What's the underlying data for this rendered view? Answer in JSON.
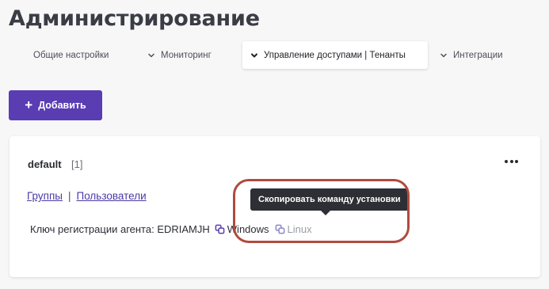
{
  "page": {
    "title": "Администрирование"
  },
  "tabs": [
    {
      "label": "Общие настройки",
      "has_chevron": false,
      "active": false
    },
    {
      "label": "Мониторинг",
      "has_chevron": true,
      "active": false
    },
    {
      "label": "Управление доступами | Тенанты",
      "has_chevron": true,
      "active": true
    },
    {
      "label": "Интеграции",
      "has_chevron": true,
      "active": false
    }
  ],
  "actions": {
    "add_label": "Добавить",
    "add_icon": "plus-icon"
  },
  "tenant": {
    "name": "default",
    "count": "[1]",
    "more_icon": "more-horizontal-icon",
    "links": {
      "groups": "Группы",
      "separator": "|",
      "users": "Пользователи"
    },
    "registration": {
      "label": "Ключ регистрации агента: EDRIAMJH",
      "windows_label": "Windows",
      "linux_label": "Linux",
      "copy_icon": "copy-icon"
    }
  },
  "tooltip": {
    "text": "Скопировать команду установки"
  },
  "colors": {
    "accent": "#5a3cb3",
    "link": "#4a3aa8",
    "tooltip_bg": "#2d2f34",
    "highlight": "#b14a3e",
    "disabled_text": "#9a9da5"
  }
}
